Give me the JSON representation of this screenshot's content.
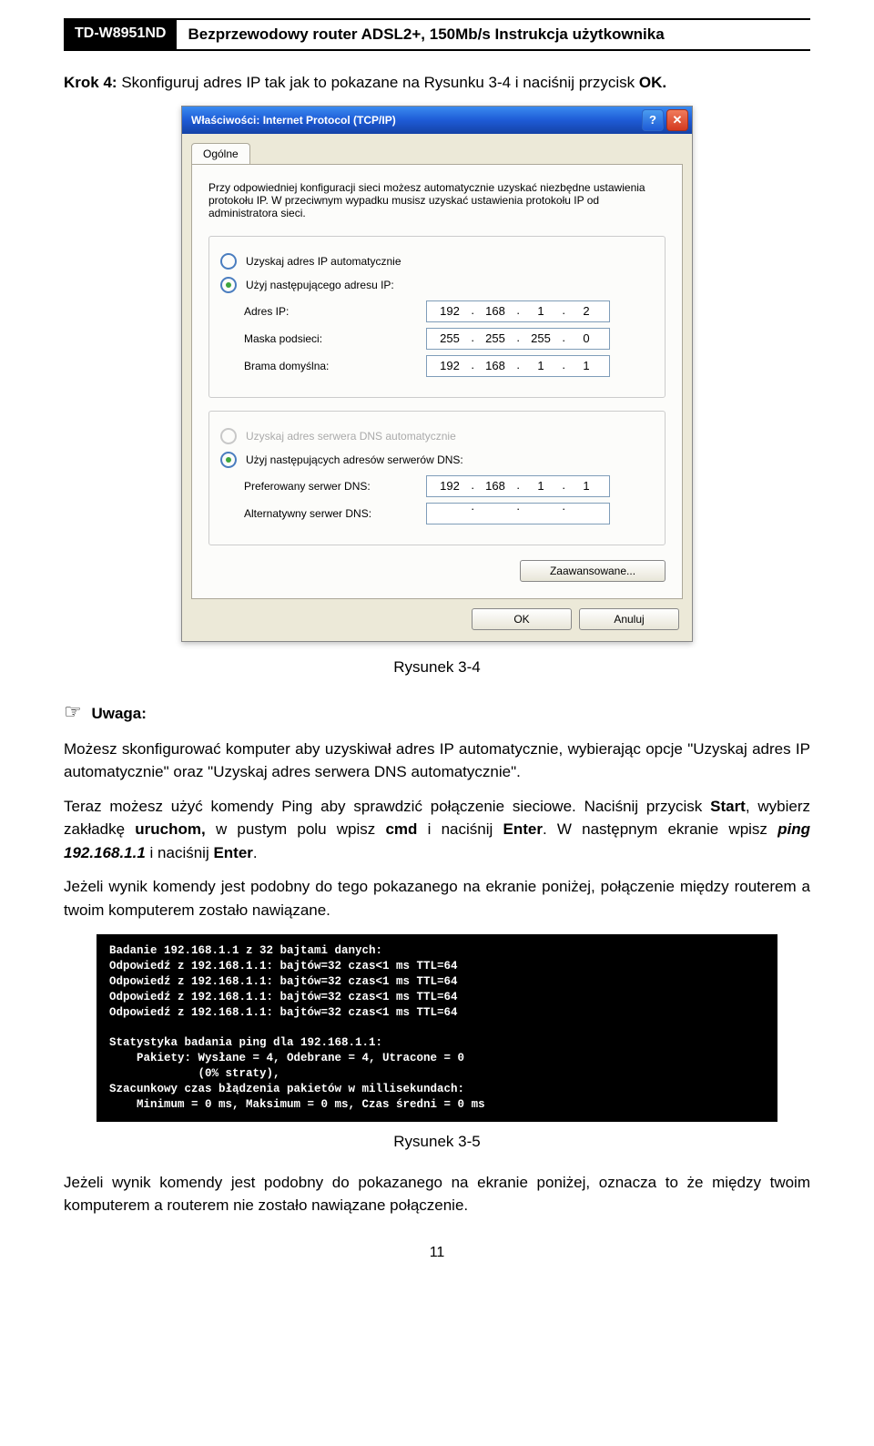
{
  "header": {
    "model": "TD-W8951ND",
    "title": "Bezprzewodowy router ADSL2+, 150Mb/s Instrukcja użytkownika"
  },
  "step4": {
    "prefix": "Krok 4:",
    "text": "Skonfiguruj adres IP tak jak to pokazane na Rysunku 3-4 i naciśnij przycisk",
    "ok": "OK"
  },
  "dialog": {
    "title": "Właściwości: Internet Protocol (TCP/IP)",
    "help_icon": "?",
    "close_icon": "✕",
    "tab": "Ogólne",
    "info": "Przy odpowiedniej konfiguracji sieci możesz automatycznie uzyskać niezbędne ustawienia protokołu IP. W przeciwnym wypadku musisz uzyskać ustawienia protokołu IP od administratora sieci.",
    "ip_auto": "Uzyskaj adres IP automatycznie",
    "ip_manual": "Użyj następującego adresu IP:",
    "ip_label": "Adres IP:",
    "mask_label": "Maska podsieci:",
    "gateway_label": "Brama domyślna:",
    "ip": [
      "192",
      "168",
      "1",
      "2"
    ],
    "mask": [
      "255",
      "255",
      "255",
      "0"
    ],
    "gateway": [
      "192",
      "168",
      "1",
      "1"
    ],
    "dns_auto": "Uzyskaj adres serwera DNS automatycznie",
    "dns_manual": "Użyj następujących adresów serwerów DNS:",
    "pref_dns_label": "Preferowany serwer DNS:",
    "alt_dns_label": "Alternatywny serwer DNS:",
    "pref_dns": [
      "192",
      "168",
      "1",
      "1"
    ],
    "alt_dns": [
      "",
      "",
      "",
      ""
    ],
    "advanced": "Zaawansowane...",
    "ok": "OK",
    "cancel": "Anuluj"
  },
  "caption1": "Rysunek 3-4",
  "note_label": "Uwaga:",
  "note_text": "Możesz skonfigurować komputer aby uzyskiwał adres IP automatycznie, wybierając opcje \"Uzyskaj adres IP automatycznie\" oraz \"Uzyskaj adres serwera DNS automatycznie\".",
  "ping_para1_a": "Teraz możesz użyć komendy Ping aby sprawdzić połączenie sieciowe. Naciśnij przycisk ",
  "ping_para1_start": "Start",
  "ping_para1_b": ", wybierz zakładkę ",
  "ping_para1_run": "uruchom,",
  "ping_para1_c": " w pustym polu wpisz ",
  "ping_para1_cmd": "cmd",
  "ping_para1_d": " i naciśnij ",
  "ping_para1_enter": "Enter",
  "ping_para1_e": ". W następnym ekranie wpisz ",
  "ping_para1_cmdline": "ping 192.168.1.1",
  "ping_para1_f": " i naciśnij ",
  "ping_para1_enter2": "Enter",
  "ping_para2": "Jeżeli wynik komendy jest podobny do tego pokazanego na ekranie poniżej, połączenie między routerem a twoim komputerem zostało nawiązane.",
  "console": "Badanie 192.168.1.1 z 32 bajtami danych:\nOdpowiedź z 192.168.1.1: bajtów=32 czas<1 ms TTL=64\nOdpowiedź z 192.168.1.1: bajtów=32 czas<1 ms TTL=64\nOdpowiedź z 192.168.1.1: bajtów=32 czas<1 ms TTL=64\nOdpowiedź z 192.168.1.1: bajtów=32 czas<1 ms TTL=64\n\nStatystyka badania ping dla 192.168.1.1:\n    Pakiety: Wysłane = 4, Odebrane = 4, Utracone = 0\n             (0% straty),\nSzacunkowy czas błądzenia pakietów w millisekundach:\n    Minimum = 0 ms, Maksimum = 0 ms, Czas średni = 0 ms",
  "caption2": "Rysunek 3-5",
  "footer_para": "Jeżeli wynik komendy jest podobny do pokazanego na ekranie poniżej, oznacza to że między twoim komputerem a routerem nie zostało nawiązane połączenie.",
  "page_number": "11"
}
